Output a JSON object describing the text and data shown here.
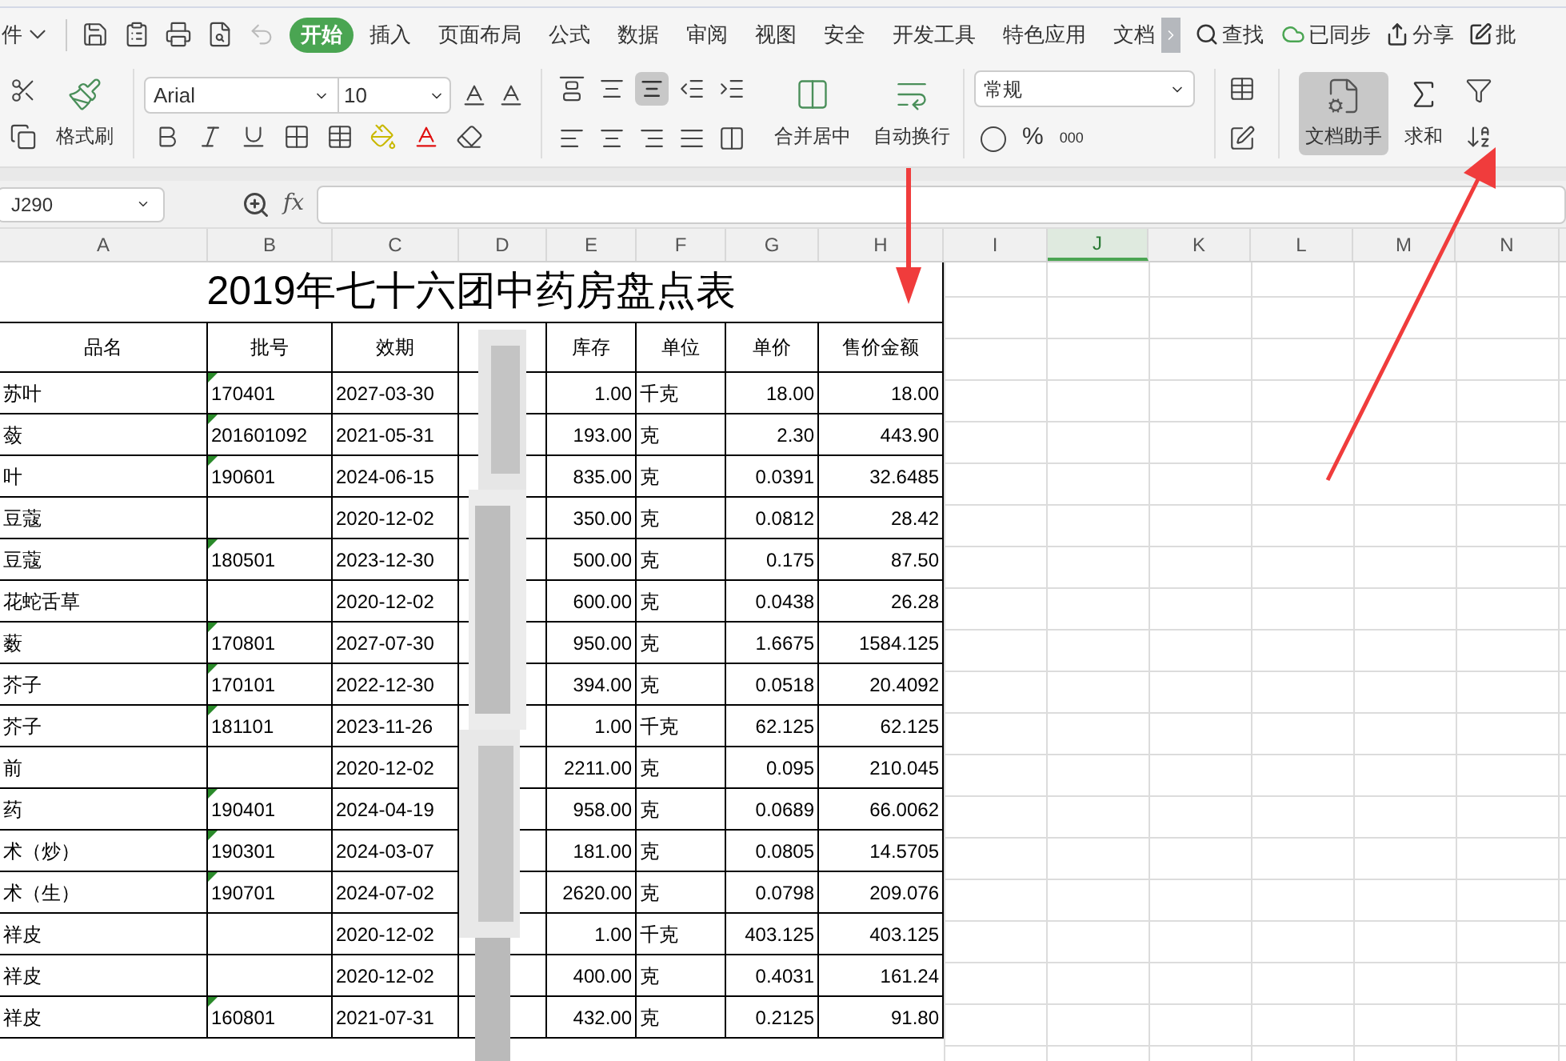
{
  "menu": {
    "file_partial": "件",
    "tabs": [
      {
        "label": "开始",
        "selected": true
      },
      {
        "label": "插入",
        "selected": false
      },
      {
        "label": "页面布局",
        "selected": false
      },
      {
        "label": "公式",
        "selected": false
      },
      {
        "label": "数据",
        "selected": false
      },
      {
        "label": "审阅",
        "selected": false
      },
      {
        "label": "视图",
        "selected": false
      },
      {
        "label": "安全",
        "selected": false
      },
      {
        "label": "开发工具",
        "selected": false
      },
      {
        "label": "特色应用",
        "selected": false
      },
      {
        "label": "文档",
        "selected": false
      }
    ],
    "search": "查找",
    "sync": "已同步",
    "share": "分享",
    "review_partial": "批"
  },
  "ribbon": {
    "format_painter": "格式刷",
    "font": "Arial",
    "size": "10",
    "merge": "合并居中",
    "wrap": "自动换行",
    "number_format": "常规",
    "percent": "%",
    "thousands": "000",
    "assistant": "文档助手",
    "sum": "求和"
  },
  "formula_bar": {
    "cell": "J290",
    "fx_label": "fx"
  },
  "sheet": {
    "columns": [
      {
        "label": "A",
        "selected": false
      },
      {
        "label": "B",
        "selected": false
      },
      {
        "label": "C",
        "selected": false
      },
      {
        "label": "D",
        "selected": false
      },
      {
        "label": "E",
        "selected": false
      },
      {
        "label": "F",
        "selected": false
      },
      {
        "label": "G",
        "selected": false
      },
      {
        "label": "H",
        "selected": false
      },
      {
        "label": "I",
        "selected": false
      },
      {
        "label": "J",
        "selected": true
      },
      {
        "label": "K",
        "selected": false
      },
      {
        "label": "L",
        "selected": false
      },
      {
        "label": "M",
        "selected": false
      },
      {
        "label": "N",
        "selected": false
      }
    ],
    "title": "2019年七十六团中药房盘点表",
    "headers": {
      "name": "品名",
      "batch": "批号",
      "expiry": "效期",
      "stock": "库存",
      "unit": "单位",
      "price": "单价",
      "amount": "售价金额"
    },
    "rows": [
      {
        "name": "苏叶",
        "batch": "170401",
        "expiry": "2027-03-30",
        "stock": "1.00",
        "unit": "千克",
        "price": "18.00",
        "amount": "18.00",
        "flagged": true
      },
      {
        "name": "蔹",
        "batch": "201601092",
        "expiry": "2021-05-31",
        "stock": "193.00",
        "unit": "克",
        "price": "2.30",
        "amount": "443.90",
        "flagged": true
      },
      {
        "name": "叶",
        "batch": "190601",
        "expiry": "2024-06-15",
        "stock": "835.00",
        "unit": "克",
        "price": "0.0391",
        "amount": "32.6485",
        "flagged": true
      },
      {
        "name": "豆蔻",
        "expiry": "2020-12-02",
        "stock": "350.00",
        "unit": "克",
        "price": "0.0812",
        "amount": "28.42",
        "flagged": false
      },
      {
        "name": "豆蔻",
        "batch": "180501",
        "expiry": "2023-12-30",
        "stock": "500.00",
        "unit": "克",
        "price": "0.175",
        "amount": "87.50",
        "flagged": true
      },
      {
        "name": "花蛇舌草",
        "expiry": "2020-12-02",
        "stock": "600.00",
        "unit": "克",
        "price": "0.0438",
        "amount": "26.28",
        "flagged": false
      },
      {
        "name": "薮",
        "batch": "170801",
        "expiry": "2027-07-30",
        "stock": "950.00",
        "unit": "克",
        "price": "1.6675",
        "amount": "1584.125",
        "flagged": true
      },
      {
        "name": "芥子",
        "batch": "170101",
        "expiry": "2022-12-30",
        "stock": "394.00",
        "unit": "克",
        "price": "0.0518",
        "amount": "20.4092",
        "flagged": true
      },
      {
        "name": "芥子",
        "batch": "181101",
        "expiry": "2023-11-26",
        "stock": "1.00",
        "unit": "千克",
        "price": "62.125",
        "amount": "62.125",
        "flagged": true
      },
      {
        "name": "前",
        "expiry": "2020-12-02",
        "stock": "2211.00",
        "unit": "克",
        "price": "0.095",
        "amount": "210.045",
        "flagged": false
      },
      {
        "name": "药",
        "batch": "190401",
        "expiry": "2024-04-19",
        "stock": "958.00",
        "unit": "克",
        "price": "0.0689",
        "amount": "66.0062",
        "flagged": true
      },
      {
        "name": "术（炒）",
        "batch": "190301",
        "expiry": "2024-03-07",
        "stock": "181.00",
        "unit": "克",
        "price": "0.0805",
        "amount": "14.5705",
        "flagged": true
      },
      {
        "name": "术（生）",
        "batch": "190701",
        "expiry": "2024-07-02",
        "stock": "2620.00",
        "unit": "克",
        "price": "0.0798",
        "amount": "209.076",
        "flagged": true
      },
      {
        "name": "祥皮",
        "expiry": "2020-12-02",
        "stock": "1.00",
        "unit": "千克",
        "price": "403.125",
        "amount": "403.125",
        "flagged": false
      },
      {
        "name": "祥皮",
        "expiry": "2020-12-02",
        "stock": "400.00",
        "unit": "克",
        "price": "0.4031",
        "amount": "161.24",
        "flagged": false
      },
      {
        "name": "祥皮",
        "batch": "160801",
        "expiry": "2021-07-31",
        "stock": "432.00",
        "unit": "克",
        "price": "0.2125",
        "amount": "91.80",
        "flagged": true
      }
    ]
  }
}
